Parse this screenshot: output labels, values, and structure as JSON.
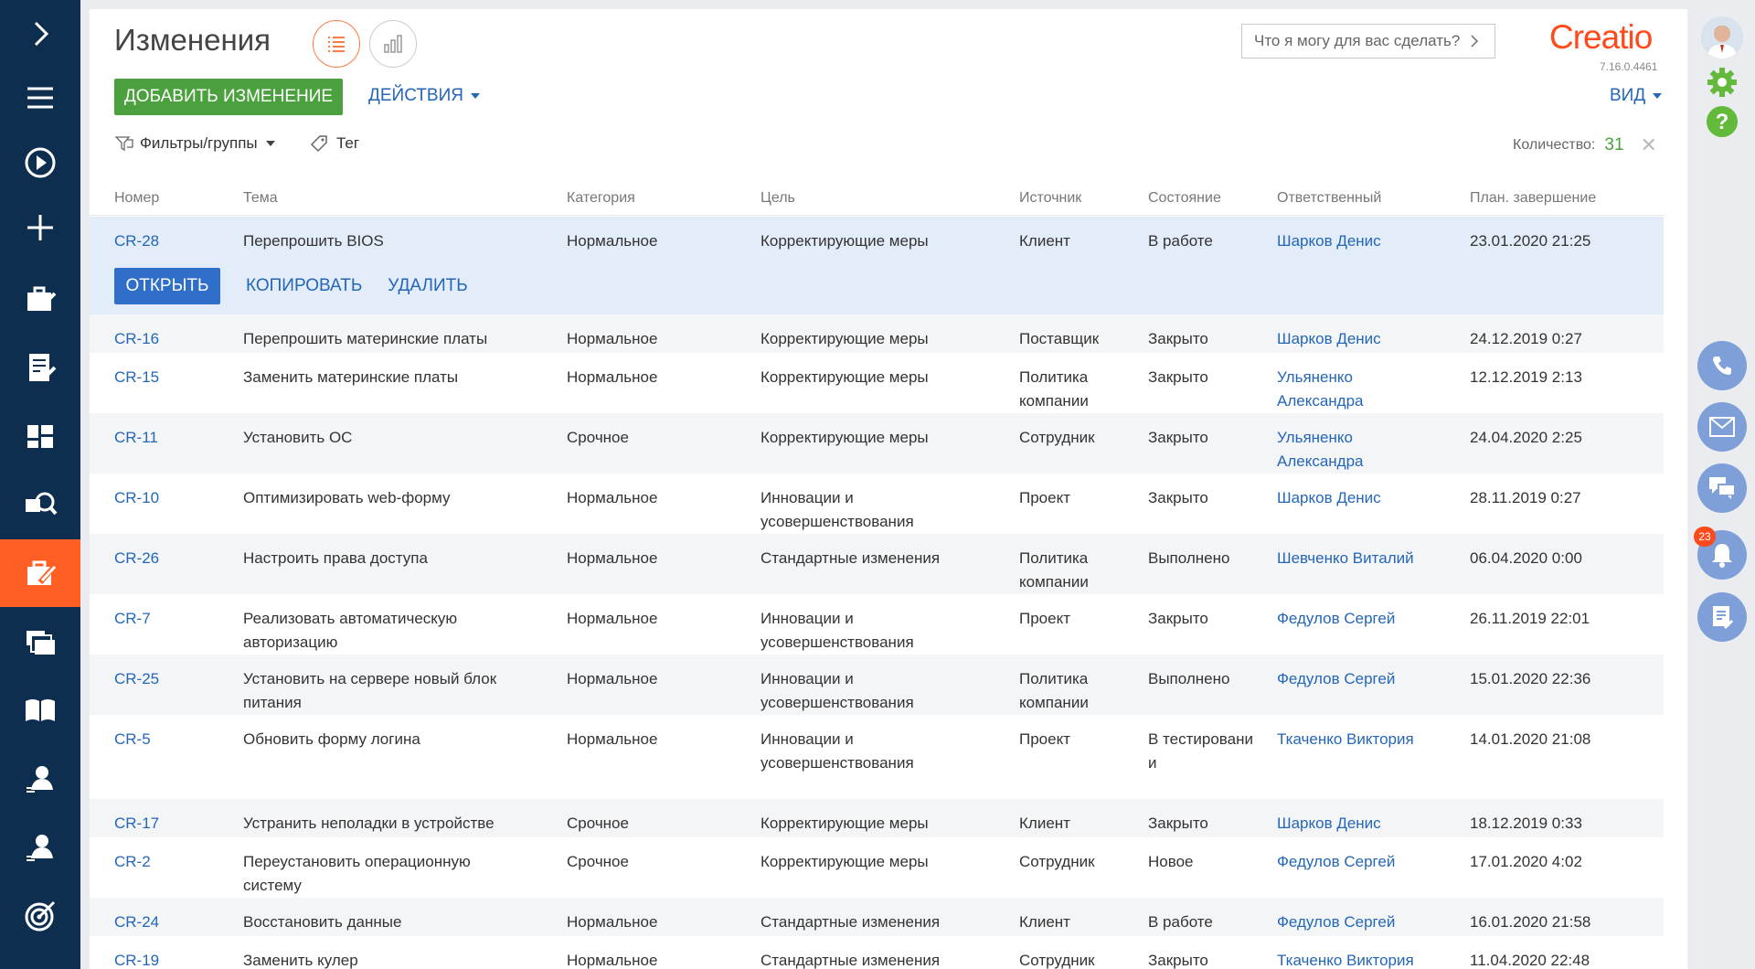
{
  "page": {
    "title": "Изменения"
  },
  "toolbar": {
    "add_label": "ДОБАВИТЬ ИЗМЕНЕНИЕ",
    "actions_label": "ДЕЙСТВИЯ",
    "view_label": "ВИД",
    "filters_label": "Фильтры/группы",
    "tag_label": "Тег",
    "count_label": "Количество:",
    "count_value": "31"
  },
  "search": {
    "placeholder": "Что я могу для вас сделать?"
  },
  "brand": {
    "logo": "Creatio",
    "version": "7.16.0.4461",
    "accent": "#ff4a1e"
  },
  "columns": [
    "Номер",
    "Тема",
    "Категория",
    "Цель",
    "Источник",
    "Состояние",
    "Ответственный",
    "План. завершение"
  ],
  "row_actions": {
    "open": "ОТКРЫТЬ",
    "copy": "КОПИРОВАТЬ",
    "delete": "УДАЛИТЬ"
  },
  "rows": [
    {
      "num": "CR-28",
      "topic": "Перепрошить BIOS",
      "category": "Нормальное",
      "goal": "Корректирующие меры",
      "source": "Клиент",
      "state": "В работе",
      "owner": "Шарков Денис",
      "due": "23.01.2020 21:25"
    },
    {
      "num": "CR-16",
      "topic": "Перепрошить материнские платы",
      "category": "Нормальное",
      "goal": "Корректирующие меры",
      "source": "Поставщик",
      "state": "Закрыто",
      "owner": "Шарков Денис",
      "due": "24.12.2019 0:27"
    },
    {
      "num": "CR-15",
      "topic": "Заменить материнские платы",
      "category": "Нормальное",
      "goal": "Корректирующие меры",
      "source": "Политика компании",
      "state": "Закрыто",
      "owner": "Ульяненко Александра",
      "due": "12.12.2019 2:13"
    },
    {
      "num": "CR-11",
      "topic": "Установить ОС",
      "category": "Срочное",
      "goal": "Корректирующие меры",
      "source": "Сотрудник",
      "state": "Закрыто",
      "owner": "Ульяненко Александра",
      "due": "24.04.2020 2:25"
    },
    {
      "num": "CR-10",
      "topic": "Оптимизировать web-форму",
      "category": "Нормальное",
      "goal": "Инновации и усовершенствования",
      "source": "Проект",
      "state": "Закрыто",
      "owner": "Шарков Денис",
      "due": "28.11.2019 0:27"
    },
    {
      "num": "CR-26",
      "topic": "Настроить права доступа",
      "category": "Нормальное",
      "goal": "Стандартные изменения",
      "source": "Политика компании",
      "state": "Выполнено",
      "owner": "Шевченко Виталий",
      "due": "06.04.2020 0:00"
    },
    {
      "num": "CR-7",
      "topic": "Реализовать автоматическую авторизацию",
      "category": "Нормальное",
      "goal": "Инновации и усовершенствования",
      "source": "Проект",
      "state": "Закрыто",
      "owner": "Федулов Сергей",
      "due": "26.11.2019 22:01"
    },
    {
      "num": "CR-25",
      "topic": "Установить на сервере новый блок питания",
      "category": "Нормальное",
      "goal": "Инновации и усовершенствования",
      "source": "Политика компании",
      "state": "Выполнено",
      "owner": "Федулов Сергей",
      "due": "15.01.2020 22:36"
    },
    {
      "num": "CR-5",
      "topic": "Обновить форму логина",
      "category": "Нормальное",
      "goal": "Инновации и усовершенствования",
      "source": "Проект",
      "state": "В тестировани и",
      "owner": "Ткаченко Виктория",
      "due": "14.01.2020 21:08"
    },
    {
      "num": "CR-17",
      "topic": "Устранить неполадки в устройстве",
      "category": "Срочное",
      "goal": "Корректирующие меры",
      "source": "Клиент",
      "state": "Закрыто",
      "owner": "Шарков Денис",
      "due": "18.12.2019 0:33"
    },
    {
      "num": "CR-2",
      "topic": "Переустановить операционную систему",
      "category": "Срочное",
      "goal": "Корректирующие меры",
      "source": "Сотрудник",
      "state": "Новое",
      "owner": "Федулов Сергей",
      "due": "17.01.2020 4:02"
    },
    {
      "num": "CR-24",
      "topic": "Восстановить данные",
      "category": "Нормальное",
      "goal": "Стандартные изменения",
      "source": "Клиент",
      "state": "В работе",
      "owner": "Федулов Сергей",
      "due": "16.01.2020 21:58"
    },
    {
      "num": "CR-19",
      "topic": "Заменить кулер",
      "category": "Нормальное",
      "goal": "Стандартные изменения",
      "source": "Сотрудник",
      "state": "Закрыто",
      "owner": "Ткаченко Виктория",
      "due": "11.04.2020 22:48"
    }
  ],
  "notifications": {
    "count": "23"
  }
}
